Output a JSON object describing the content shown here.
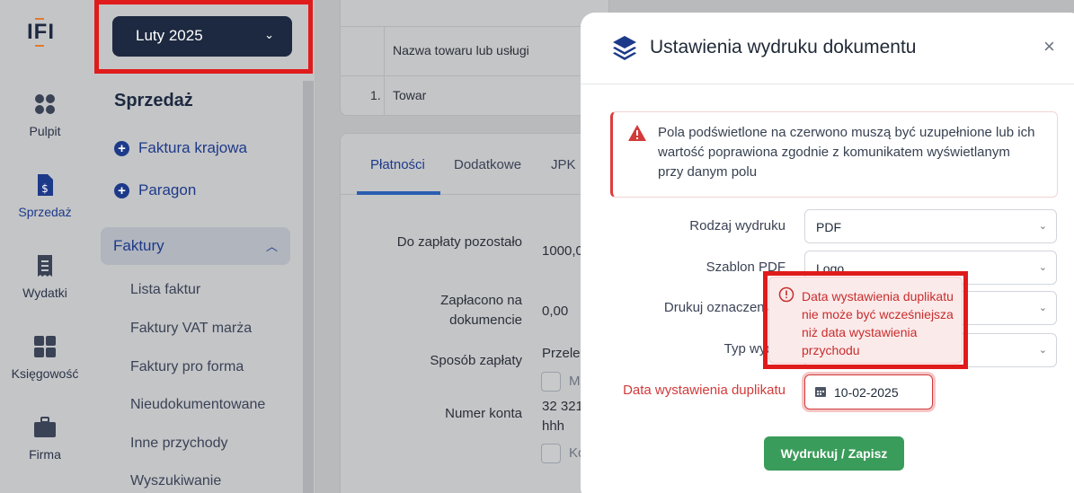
{
  "rail": {
    "logo": "IFI",
    "items": [
      {
        "label": "Pulpit",
        "icon": "dashboard-icon"
      },
      {
        "label": "Sprzedaż",
        "icon": "invoice-dollar-icon"
      },
      {
        "label": "Wydatki",
        "icon": "receipt-icon"
      },
      {
        "label": "Księgowość",
        "icon": "calculator-icon"
      },
      {
        "label": "Firma",
        "icon": "briefcase-icon"
      }
    ]
  },
  "sidebar": {
    "month": "Luty 2025",
    "title": "Sprzedaż",
    "links": [
      "Faktura krajowa",
      "Paragon"
    ],
    "group": "Faktury",
    "subitems": [
      "Lista faktur",
      "Faktury VAT marża",
      "Faktury pro forma",
      "Nieudokumentowane",
      "Inne przychody",
      "Wyszukiwanie"
    ]
  },
  "main": {
    "table": {
      "header": "Nazwa towaru lub usługi",
      "row_no": "1.",
      "row_name": "Towar"
    },
    "tabs": [
      "Płatności",
      "Dodatkowe",
      "JPK"
    ],
    "fields": {
      "do_zaplaty_label": "Do zapłaty pozostało",
      "do_zaplaty_value": "1000,0",
      "zaplacono_label": "Zapłacono na dokumencie",
      "zaplacono_value": "0,00",
      "sposob_label": "Sposób zapłaty",
      "sposob_value": "Przele",
      "cb1_label": "M",
      "numer_label": "Numer konta",
      "numer_value": "32 321",
      "numer_value2": "hhh",
      "cb2_label": "Ko"
    }
  },
  "modal": {
    "title": "Ustawienia wydruku dokumentu",
    "close": "×",
    "alert": "Pola podświetlone na czerwono muszą być uzupełnione lub ich wartość poprawiona zgodnie z komunikatem wyświetlanym przy danym polu",
    "labels": {
      "rodzaj": "Rodzaj wydruku",
      "szablon": "Szablon PDF",
      "drukuj": "Drukuj oznaczenia J",
      "typ": "Typ wydru",
      "data": "Data wystawienia duplikatu"
    },
    "values": {
      "rodzaj": "PDF",
      "szablon": "Logo",
      "drukuj": "",
      "typ": "",
      "data": "10-02-2025"
    },
    "save_label": "Wydrukuj / Zapisz"
  },
  "tooltip": "Data wystawienia duplikatu nie może być wcześniejsza niż data wystawienia przychodu",
  "colors": {
    "accent": "#1d3a8a",
    "error": "#d23a3a",
    "success": "#3a9c5a",
    "highlight_frame": "#e01b1b"
  }
}
